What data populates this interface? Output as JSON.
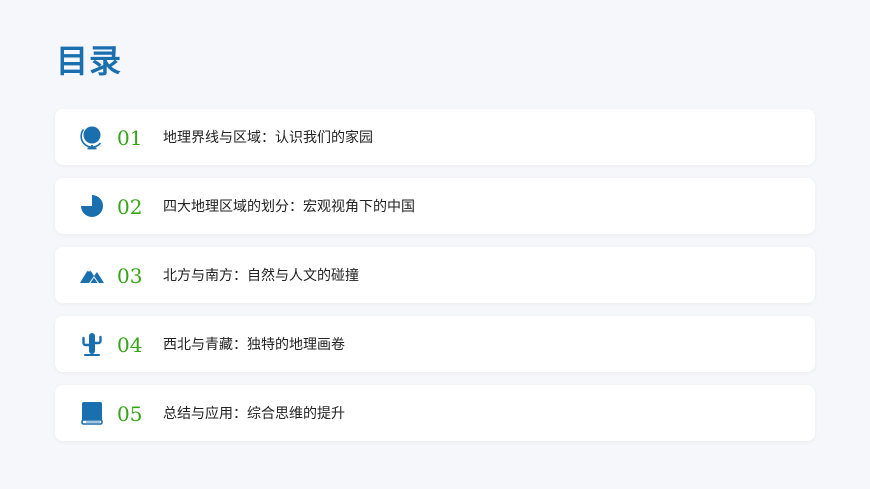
{
  "page": {
    "title": "目录"
  },
  "colors": {
    "title": "#1a6fae",
    "icon": "#1a6fae",
    "number": "#34a516",
    "card_bg": "#ffffff",
    "page_bg": "#f6f7fa"
  },
  "items": [
    {
      "icon": "globe-icon",
      "number": "01",
      "label": "地理界线与区域：认识我们的家园"
    },
    {
      "icon": "pie-chart-icon",
      "number": "02",
      "label": "四大地理区域的划分：宏观视角下的中国"
    },
    {
      "icon": "mountain-icon",
      "number": "03",
      "label": "北方与南方：自然与人文的碰撞"
    },
    {
      "icon": "cactus-icon",
      "number": "04",
      "label": "西北与青藏：独特的地理画卷"
    },
    {
      "icon": "book-icon",
      "number": "05",
      "label": "总结与应用：综合思维的提升"
    }
  ]
}
